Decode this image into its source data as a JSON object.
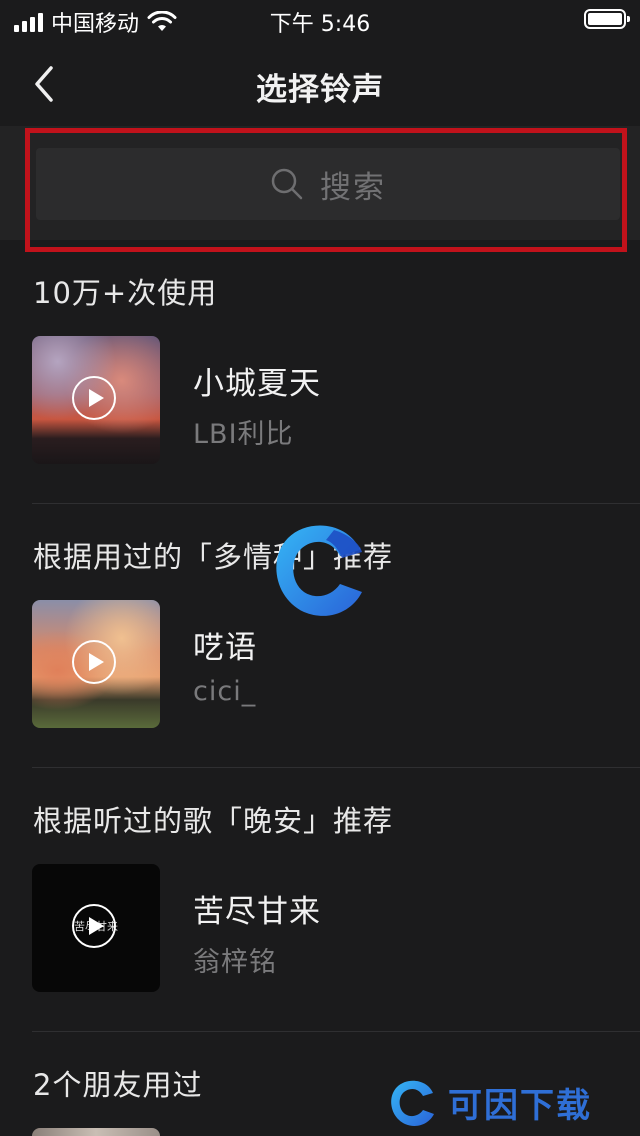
{
  "status_bar": {
    "carrier": "中国移动",
    "time": "下午 5:46"
  },
  "nav": {
    "title": "选择铃声"
  },
  "search": {
    "placeholder": "搜索"
  },
  "sections": [
    {
      "title": "10万+次使用",
      "song": {
        "title": "小城夏天",
        "artist": "LBI利比"
      }
    },
    {
      "title": "根据用过的「多情种」推荐",
      "song": {
        "title": "呓语",
        "artist": "cici_"
      }
    },
    {
      "title": "根据听过的歌「晚安」推荐",
      "song": {
        "title": "苦尽甘来",
        "artist": "翁梓铭",
        "cover_text": "苦尽甘来"
      }
    },
    {
      "title": "2个朋友用过"
    }
  ],
  "watermark": {
    "text": "可因下载"
  },
  "colors": {
    "background": "#1b1b1c",
    "highlight_border": "#c1121b",
    "watermark_blue": "#2f6fd6"
  }
}
